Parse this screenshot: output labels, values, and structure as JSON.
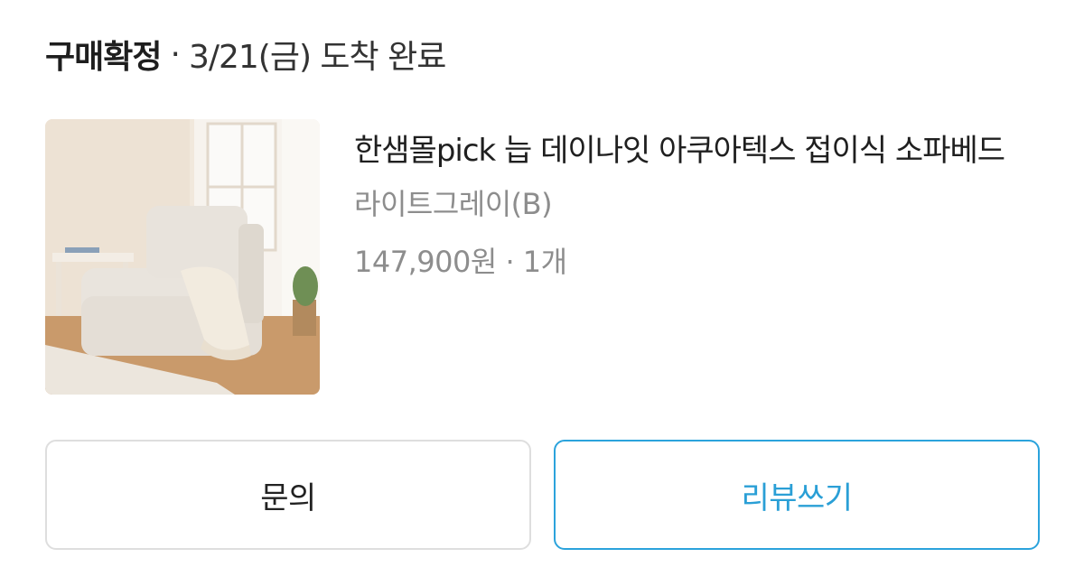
{
  "header": {
    "status": "구매확정",
    "separator": "·",
    "delivery": "3/21(금) 도착 완료"
  },
  "product": {
    "image_icon": "sofa-bed-product-photo",
    "title": "한샘몰pick 늡 데이나잇 아쿠아텍스 접이식 소파베드",
    "option": "라이트그레이(B)",
    "price": "147,900원",
    "separator": "·",
    "quantity": "1개"
  },
  "buttons": {
    "inquiry_label": "문의",
    "review_label": "리뷰쓰기"
  },
  "colors": {
    "accent": "#2ba3dc",
    "muted_text": "#8d8d8d",
    "border": "#dedede"
  }
}
